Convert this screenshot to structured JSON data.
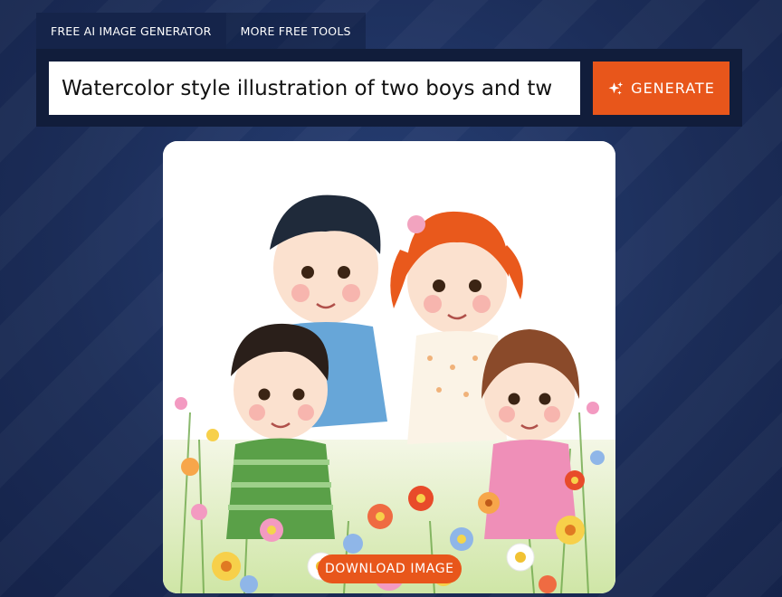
{
  "tabs": [
    {
      "label": "FREE AI IMAGE GENERATOR",
      "active": true
    },
    {
      "label": "MORE FREE TOOLS",
      "active": false
    }
  ],
  "prompt": {
    "value": "Watercolor style illustration of two boys and tw"
  },
  "generate": {
    "label": "GENERATE",
    "icon": "sparkle-icon"
  },
  "image": {
    "download_label": "DOWNLOAD IMAGE"
  },
  "colors": {
    "accent": "#e8561b",
    "panel": "#111d3b",
    "background": "#1d2f5b"
  }
}
